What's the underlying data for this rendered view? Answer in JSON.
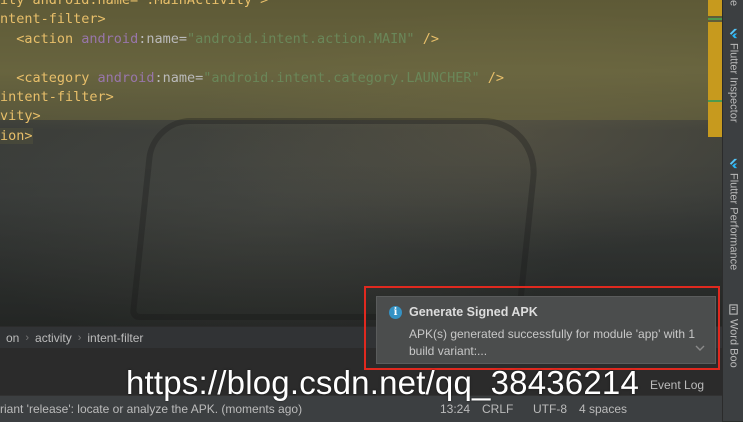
{
  "editor": {
    "lines": [
      {
        "kind": "partial-top",
        "text": "ity android:name=\".MainActivity\">"
      },
      {
        "kind": "tag-close-open",
        "text": "ntent-filter>"
      },
      {
        "kind": "action",
        "indent": "  ",
        "open": "<action ",
        "ns": "android",
        "attr": ":name=",
        "value": "\"android.intent.action.MAIN\"",
        "close": " />"
      },
      {
        "kind": "blank",
        "text": ""
      },
      {
        "kind": "category",
        "indent": "  ",
        "open": "<category ",
        "ns": "android",
        "attr": ":name=",
        "value": "\"android.intent.category.LAUNCHER\"",
        "close": " />"
      },
      {
        "kind": "tag",
        "text": "intent-filter>"
      },
      {
        "kind": "tag",
        "text": "vity>"
      },
      {
        "kind": "tag",
        "text": "ion>"
      }
    ]
  },
  "breadcrumb": [
    "on",
    "activity",
    "intent-filter"
  ],
  "tool_windows": [
    {
      "label": "Flutter Inspector",
      "icon": "flutter-icon"
    },
    {
      "label": "Flutter Performance",
      "icon": "flutter-icon"
    },
    {
      "label": "Word Boo",
      "icon": "book-icon"
    }
  ],
  "notification": {
    "title": "Generate Signed APK",
    "body": "APK(s) generated successfully for module 'app' with 1 build variant:...",
    "icon": "info-icon",
    "outline_color": "#e0291f"
  },
  "statusbar": {
    "message": "riant 'release': locate or analyze the APK. (moments ago)",
    "position": "13:24",
    "line_sep": "CRLF",
    "encoding": "UTF-8",
    "indent": "4 spaces",
    "event_log": "Event Log"
  },
  "watermark": "https://blog.csdn.net/qq_38436214",
  "colors": {
    "tag": "#e8bf6a",
    "namespace": "#9876aa",
    "value": "#6a8759",
    "scroll_marker": "#c79a1e"
  }
}
